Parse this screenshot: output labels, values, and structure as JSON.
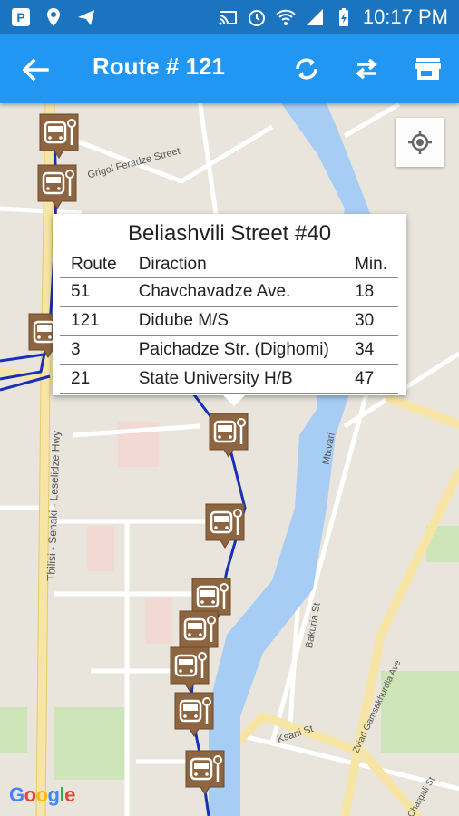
{
  "status_bar": {
    "time": "10:17 PM"
  },
  "app_bar": {
    "title": "Route # 121"
  },
  "info_window": {
    "title": "Beliashvili Street #40",
    "columns": [
      "Route",
      "Diraction",
      "Min."
    ],
    "rows": [
      {
        "route": "51",
        "direction": "Chavchavadze Ave.",
        "min": "18"
      },
      {
        "route": "121",
        "direction": "Didube M/S",
        "min": "30"
      },
      {
        "route": "3",
        "direction": "Paichadze Str. (Dighomi)",
        "min": "34"
      },
      {
        "route": "21",
        "direction": "State University H/B",
        "min": "47"
      }
    ]
  },
  "map": {
    "road_labels": {
      "feradze": "Grigol Feradze Street",
      "highway": "Tbilisi - Senaki - Leselidze Hwy",
      "mtkvari": "Mtkvari",
      "bakuria": "Bakuria St",
      "ksani": "Ksani St",
      "gamsakhurdia": "Zviad Gamsakhurdia Ave",
      "chargali": "Chargali St"
    },
    "logo_text": "Google",
    "icons": {
      "bus_stop": "bus-stop-marker-icon",
      "locate": "my-location-icon"
    },
    "colors": {
      "route_line": "#1a2fb8",
      "marker": "#8d6540",
      "river": "#a8cdf5",
      "app_bar": "#2196f3",
      "status_bar": "#1b74bf"
    }
  }
}
